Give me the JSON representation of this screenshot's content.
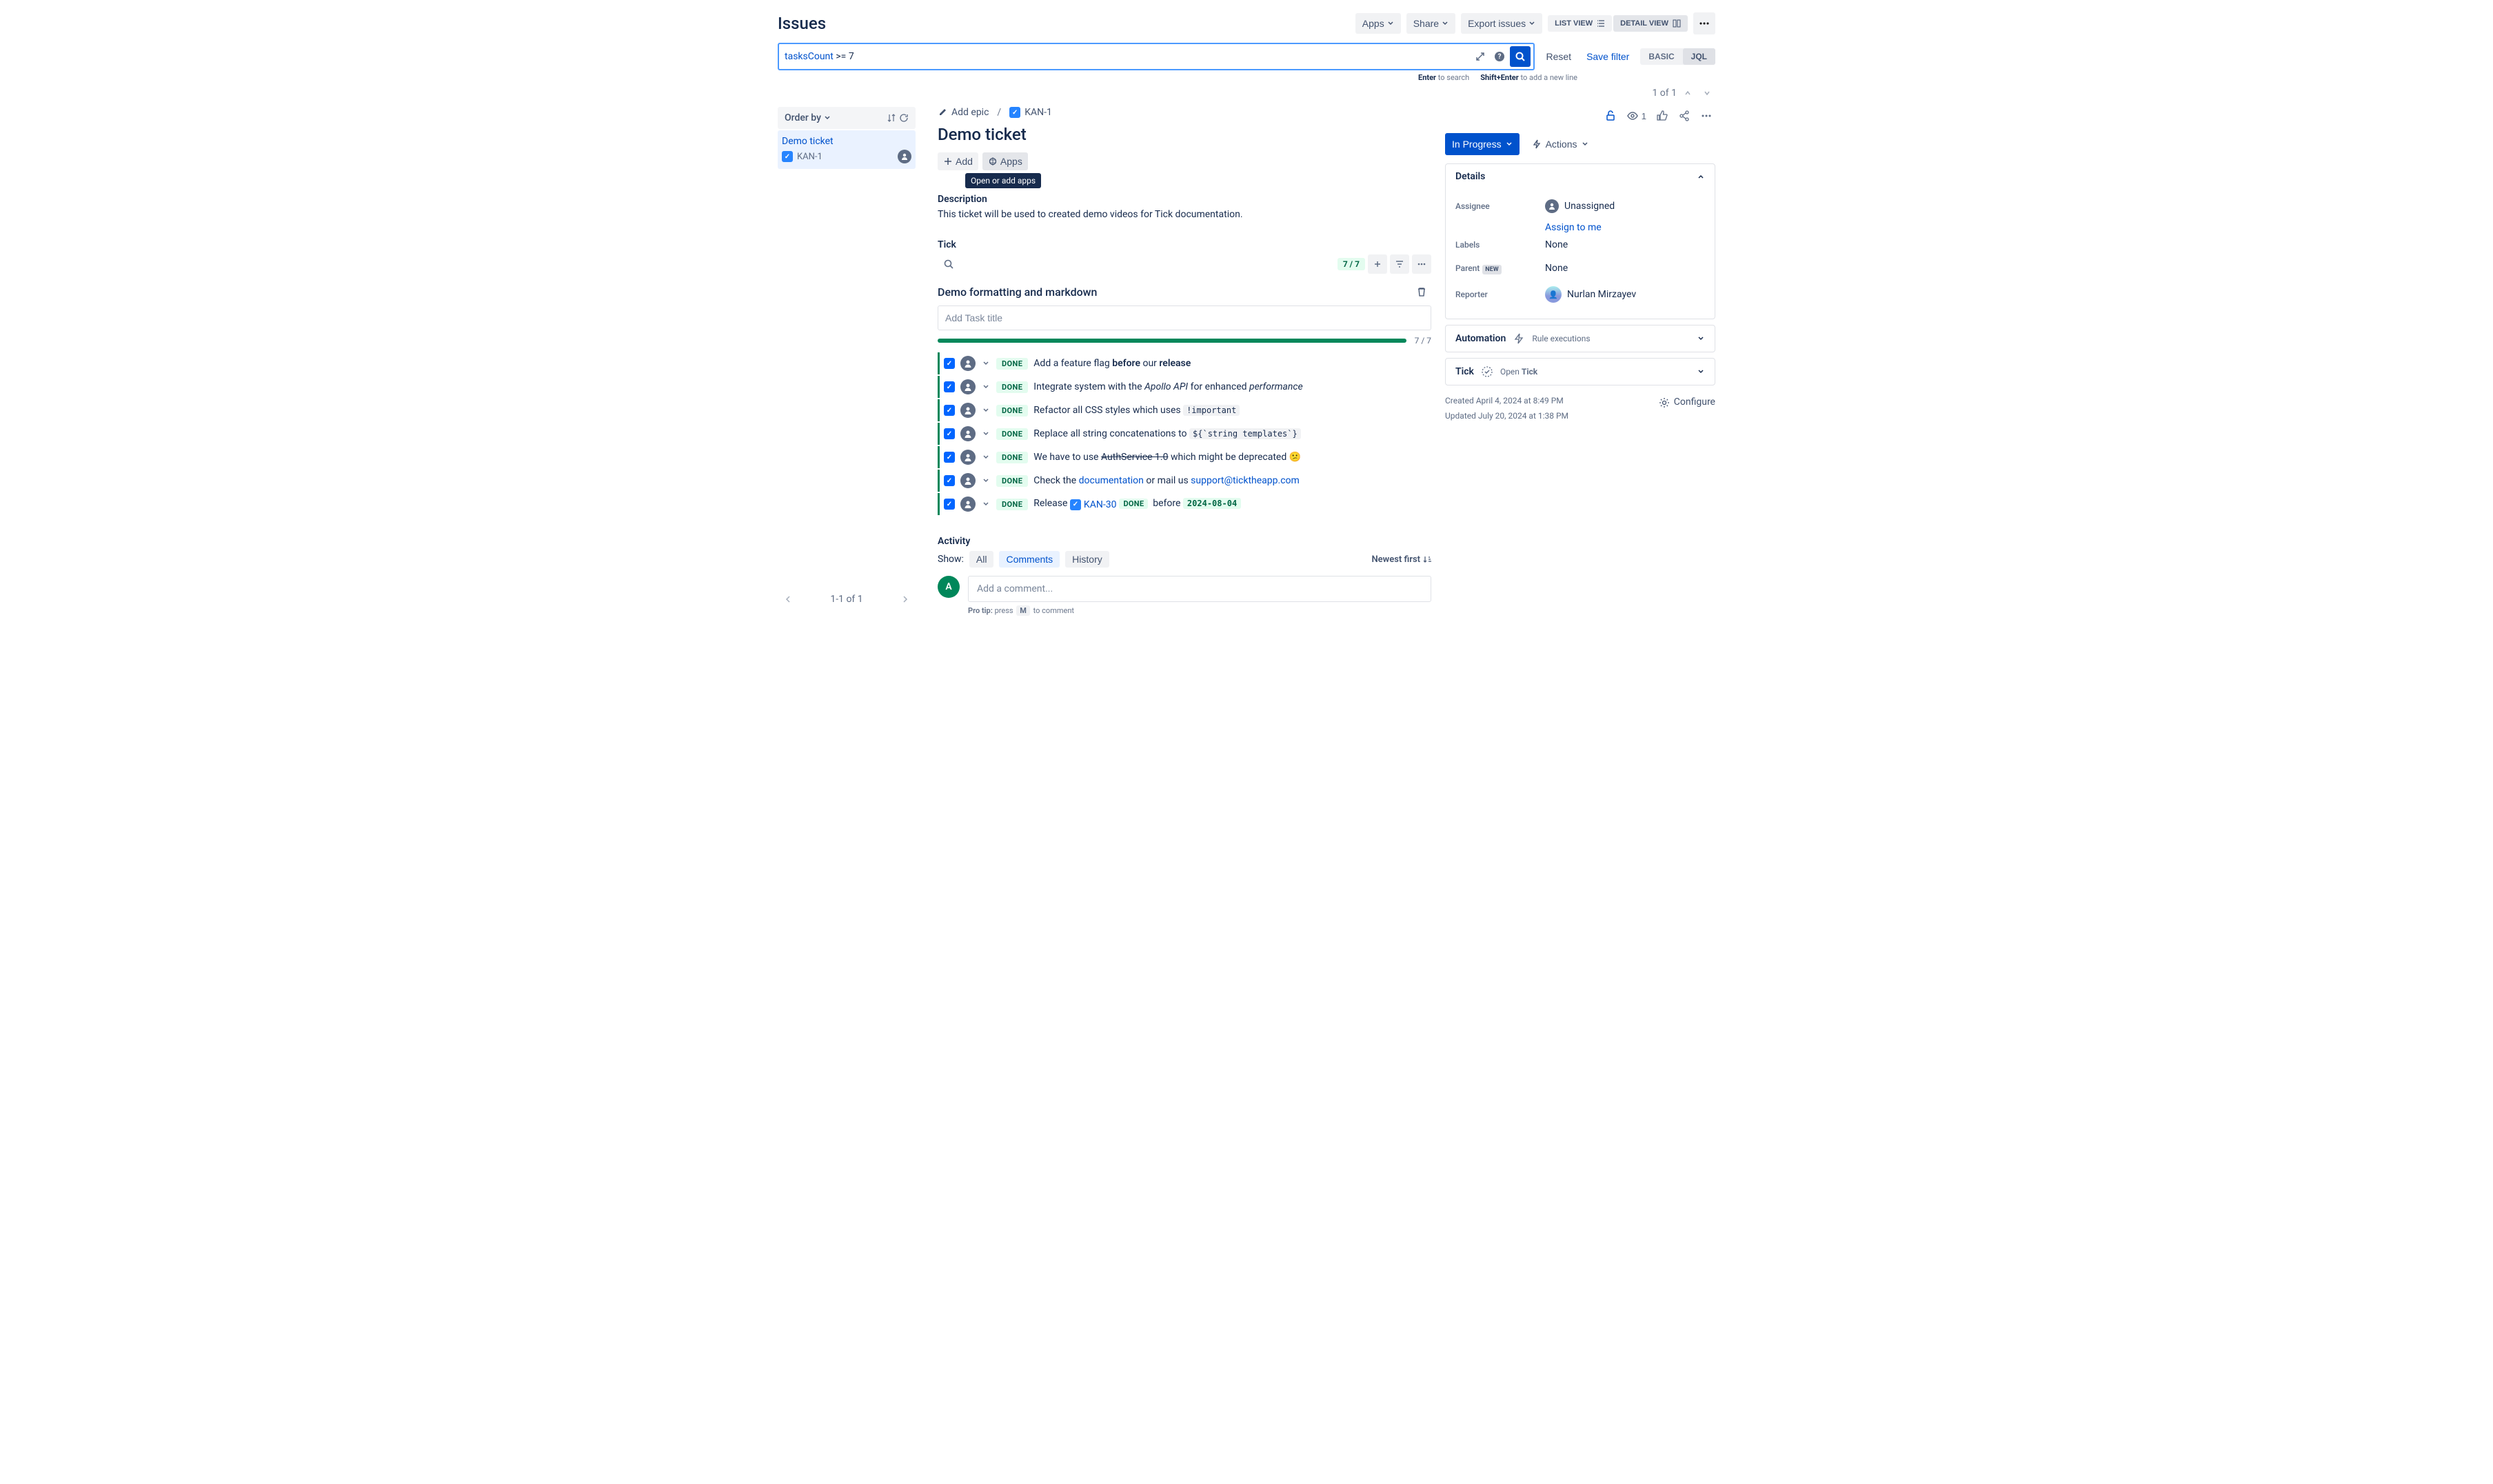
{
  "page_title": "Issues",
  "header": {
    "apps": "Apps",
    "share": "Share",
    "export": "Export issues",
    "list_view": "LIST VIEW",
    "detail_view": "DETAIL VIEW"
  },
  "jql": {
    "field": "tasksCount",
    "operator": ">=",
    "value": "7",
    "reset": "Reset",
    "save_filter": "Save filter",
    "mode_basic": "BASIC",
    "mode_jql": "JQL",
    "hint_enter_key": "Enter",
    "hint_enter_rest": "to search",
    "hint_shift_key": "Shift+Enter",
    "hint_shift_rest": "to add a new line"
  },
  "pager": {
    "text": "1 of 1"
  },
  "sidebar": {
    "order_by": "Order by",
    "items": [
      {
        "summary": "Demo ticket",
        "key": "KAN-1"
      }
    ],
    "footer": "1-1 of 1"
  },
  "detail": {
    "breadcrumb": {
      "add_epic": "Add epic",
      "issue_key": "KAN-1"
    },
    "title": "Demo ticket",
    "buttons": {
      "add": "Add",
      "apps": "Apps"
    },
    "tooltip": "Open or add apps",
    "description_label": "Description",
    "description_text": "This ticket will be used to created demo videos for Tick documentation.",
    "tick_label": "Tick",
    "tick_count": "7 / 7",
    "tick_subtitle": "Demo formatting and markdown",
    "add_task_placeholder": "Add Task title",
    "progress_text": "7 / 7",
    "progress_percent": 100,
    "tasks": [
      {
        "status": "DONE",
        "html": "Add a feature flag <b>before</b> our <b>release</b>"
      },
      {
        "status": "DONE",
        "html": "Integrate system with the <em>Apollo API</em> for enhanced <em>performance</em>"
      },
      {
        "status": "DONE",
        "html": "Refactor all CSS styles which uses <code>!important</code>"
      },
      {
        "status": "DONE",
        "html": "Replace all string concatenations to <code>${`string templates`}</code>"
      },
      {
        "status": "DONE",
        "html": "We have to use <s>AuthService 1.0</s> which might be deprecated 😕"
      },
      {
        "status": "DONE",
        "html": "Check the <a>documentation</a> or mail us <a>support@ticktheapp.com</a>"
      },
      {
        "status": "DONE",
        "html": "Release <span class='lozenge-link'><span class='type-icon'></span> KAN-30</span><span class='status-mini'>DONE</span> &nbsp;before <span class='date-loz'>2024-08-04</span>"
      }
    ],
    "activity": {
      "label": "Activity",
      "show": "Show:",
      "tabs": {
        "all": "All",
        "comments": "Comments",
        "history": "History"
      },
      "sort": "Newest first",
      "comment_placeholder": "Add a comment...",
      "comment_initial": "A",
      "pro_tip_bold": "Pro tip:",
      "pro_tip_press": "press",
      "pro_tip_key": "M",
      "pro_tip_rest": "to comment"
    }
  },
  "right": {
    "watch_count": "1",
    "status": "In Progress",
    "actions": "Actions",
    "details": {
      "title": "Details",
      "assignee_label": "Assignee",
      "assignee_value": "Unassigned",
      "assign_to_me": "Assign to me",
      "labels_label": "Labels",
      "labels_value": "None",
      "parent_label": "Parent",
      "parent_new": "NEW",
      "parent_value": "None",
      "reporter_label": "Reporter",
      "reporter_value": "Nurlan Mirzayev"
    },
    "automation": {
      "title": "Automation",
      "sub": "Rule executions"
    },
    "tick_row": {
      "title": "Tick",
      "open_prefix": "Open ",
      "open_bold": "Tick"
    },
    "dates": {
      "created": "Created April 4, 2024 at 8:49 PM",
      "updated": "Updated July 20, 2024 at 1:38 PM"
    },
    "configure": "Configure"
  }
}
